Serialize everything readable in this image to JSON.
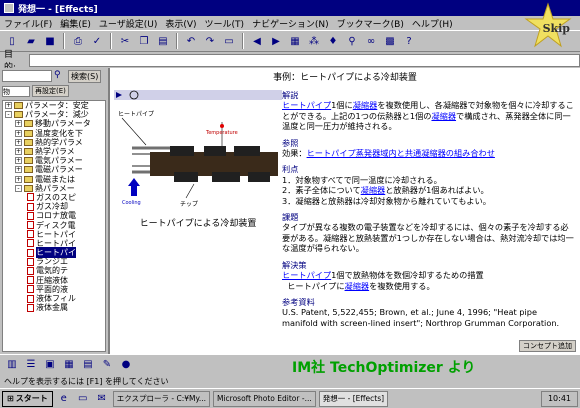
{
  "window": {
    "title": "発想一 - [Effects]"
  },
  "menu": [
    "ファイル(F)",
    "編集(E)",
    "ユーザ設定(U)",
    "表示(V)",
    "ツール(T)",
    "ナビゲーション(N)",
    "ブックマーク(B)",
    "ヘルプ(H)"
  ],
  "skip_label": "Skip",
  "purpose": {
    "label": "目的:",
    "value": ""
  },
  "left": {
    "search_btn": "検索(S)",
    "filter_value": "物",
    "filter_btn": "再設定(E)",
    "tree": [
      {
        "label": "パラメータ：安定",
        "kind": "folder",
        "exp": "+"
      },
      {
        "label": "パラメータ：減少",
        "kind": "folder",
        "exp": "-"
      },
      {
        "label": "移動パラメータ",
        "kind": "folder",
        "exp": "+"
      },
      {
        "label": "温度変化を下",
        "kind": "folder",
        "exp": "+"
      },
      {
        "label": "熱的学パラメ",
        "kind": "folder",
        "exp": "+"
      },
      {
        "label": "熱学パラメ",
        "kind": "folder",
        "exp": "+"
      },
      {
        "label": "電気パラメー",
        "kind": "folder",
        "exp": "+"
      },
      {
        "label": "電磁パラメー",
        "kind": "folder",
        "exp": "+"
      },
      {
        "label": "電磁または",
        "kind": "folder",
        "exp": "+"
      },
      {
        "label": "熱パラメー",
        "kind": "folder",
        "exp": "-"
      },
      {
        "label": "ガスのスピ",
        "kind": "doc"
      },
      {
        "label": "ガス冷却",
        "kind": "doc"
      },
      {
        "label": "コロナ放電",
        "kind": "doc"
      },
      {
        "label": "ディスク電",
        "kind": "doc"
      },
      {
        "label": "ヒートパイ",
        "kind": "doc"
      },
      {
        "label": "ヒートパイ",
        "kind": "doc"
      },
      {
        "label": "ヒートパイ",
        "kind": "doc",
        "selected": true
      },
      {
        "label": "ランジエ",
        "kind": "doc"
      },
      {
        "label": "電気的テ",
        "kind": "doc"
      },
      {
        "label": "圧縮液体",
        "kind": "doc"
      },
      {
        "label": "平面的液",
        "kind": "doc"
      },
      {
        "label": "液体フィル",
        "kind": "doc"
      },
      {
        "label": "液体金属",
        "kind": "doc"
      }
    ]
  },
  "main": {
    "title": "事例：ヒートパイプによる冷却装置",
    "diagram": {
      "label_pipe": "ヒートパイプ",
      "label_temp": "Temperature",
      "label_cooling": "Cooling",
      "label_chip": "チップ"
    },
    "caption": "ヒートパイプによる冷却装置",
    "sections": {
      "desc_head": "解説",
      "desc_link1": "ヒートパイプ",
      "desc_t1": "1個に",
      "desc_link2": "凝縮器",
      "desc_t2": "を複数使用し、各凝縮器で対象物を個々に冷却することができる。上記の1つの伝熱器と1個の",
      "desc_link3": "凝縮器",
      "desc_t3": "で構成され、蒸発器全体に同一温度と同一圧力が維持される。",
      "ref_head": "参照",
      "ref_t": "効果：",
      "ref_link": "ヒートパイプ蒸発器域内と共通凝縮器の組み合わせ",
      "adv_head": "利点",
      "adv1": "1．対象物すべてで同一温度に冷却される。",
      "adv2a": "2．素子全体について",
      "adv2_link": "凝縮器",
      "adv2b": "と放熱器が1個あればよい。",
      "adv3": "3．凝縮器と放熱器は冷却対象物から離れていてもよい。",
      "task_head": "課題",
      "task_t": "タイプが異なる複数の電子装置などを冷却するには、個々の素子を冷却する必要がある。凝縮器と放熱装置が1つしか存在しない場合は、熱対流冷却では均一な温度が得られない。",
      "sol_head": "解決策",
      "sol_link1": "ヒートパイプ",
      "sol_t1": "1個で放熱物体を数個冷却するための措置",
      "sol_t2a": "ヒートパイプに",
      "sol_link2": "凝縮器",
      "sol_t2b": "を複数使用する。",
      "lit_head": "参考資料",
      "lit_t": "U.S. Patent, 5,522,455; Brown, et al.; June 4, 1996; \"Heat pipe manifold with screen-lined insert\"; Northrop Grumman Corporation."
    },
    "concept_btn": "コンセプト追加"
  },
  "status_text": "ヘルプを表示するには [F1] を押してください",
  "credit": "IM社 TechOptimizer より",
  "taskbar": {
    "start": "スタート",
    "tasks": [
      "エクスプローラ - C:¥My...",
      "Microsoft Photo Editor -...",
      "発想一 - [Effects]"
    ],
    "clock": "10:41"
  }
}
